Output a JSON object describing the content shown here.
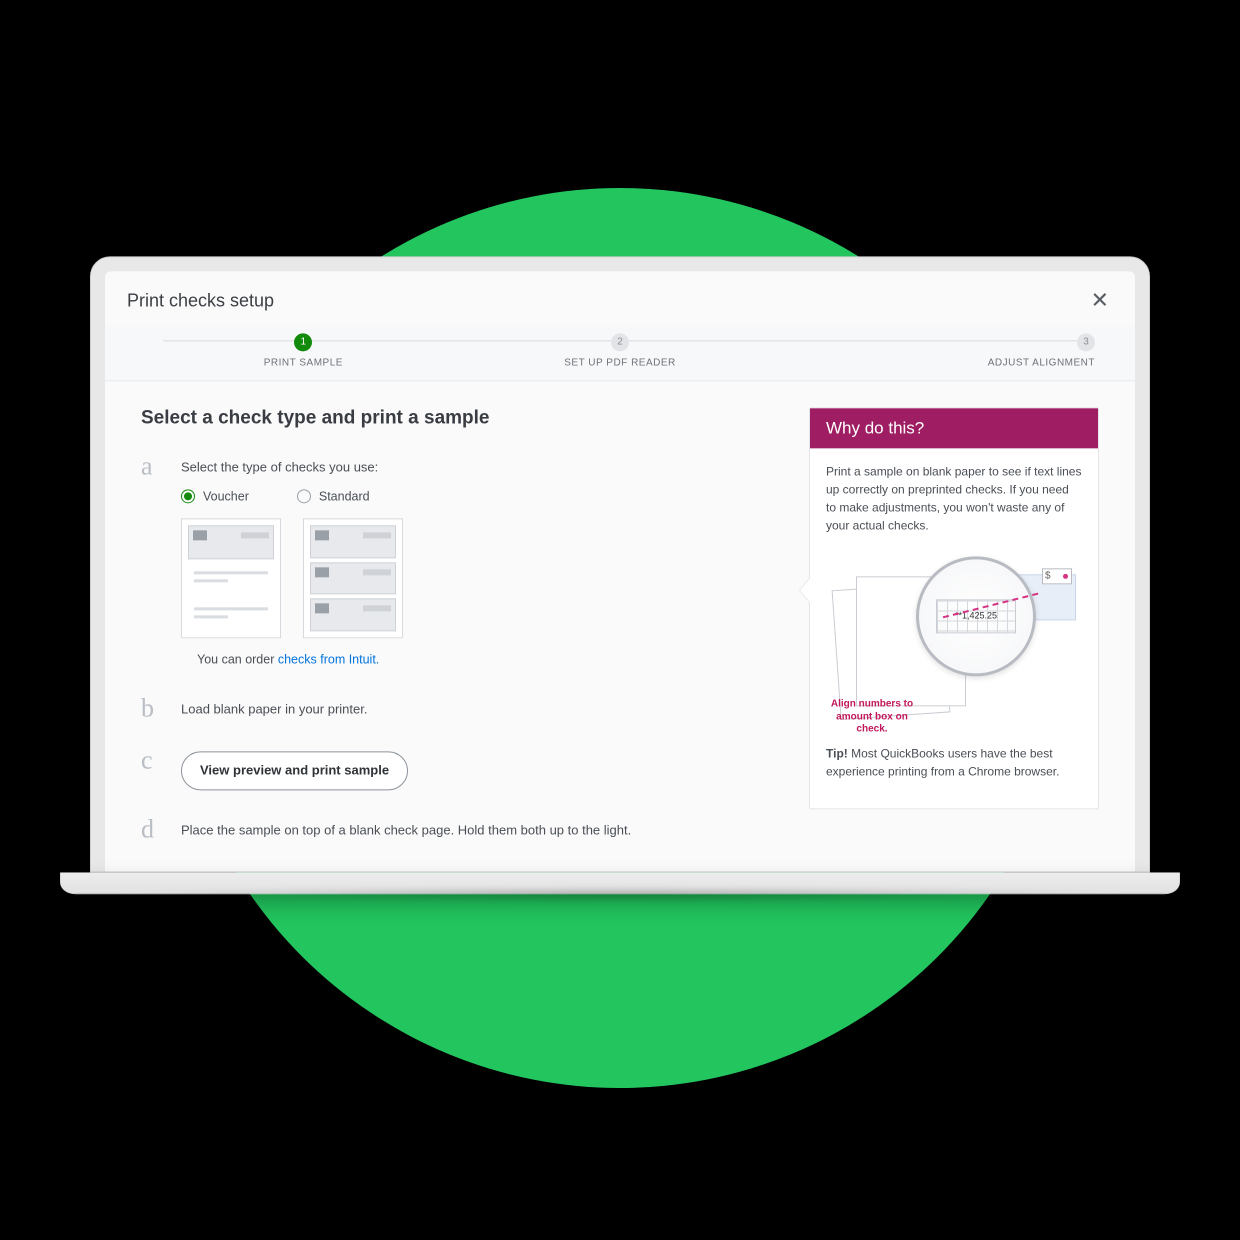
{
  "header": {
    "title": "Print checks setup"
  },
  "stepper": {
    "steps": [
      {
        "num": "1",
        "label": "PRINT SAMPLE"
      },
      {
        "num": "2",
        "label": "SET UP PDF READER"
      },
      {
        "num": "3",
        "label": "ADJUST ALIGNMENT"
      }
    ]
  },
  "main": {
    "heading": "Select a check type and print a sample",
    "step_a": {
      "letter": "a",
      "text": "Select the type of checks you use:",
      "option_voucher": "Voucher",
      "option_standard": "Standard",
      "order_prefix": "You can order ",
      "order_link": "checks from Intuit."
    },
    "step_b": {
      "letter": "b",
      "text": "Load blank paper in your printer."
    },
    "step_c": {
      "letter": "c",
      "button": "View preview and print sample"
    },
    "step_d": {
      "letter": "d",
      "text": "Place the sample on top of a blank check page. Hold them both up to the light."
    }
  },
  "sidebar": {
    "title": "Why do this?",
    "body": "Print a sample on blank paper to see if text lines up correctly on preprinted checks. If you need to make adjustments, you won't waste any of your actual checks.",
    "illus_amount": "**1,425.25",
    "illus_dollar": "$",
    "illus_caption": "Align numbers to amount box on check.",
    "tip_label": "Tip!",
    "tip_text": " Most QuickBooks users have the best experience printing from a Chrome browser."
  }
}
